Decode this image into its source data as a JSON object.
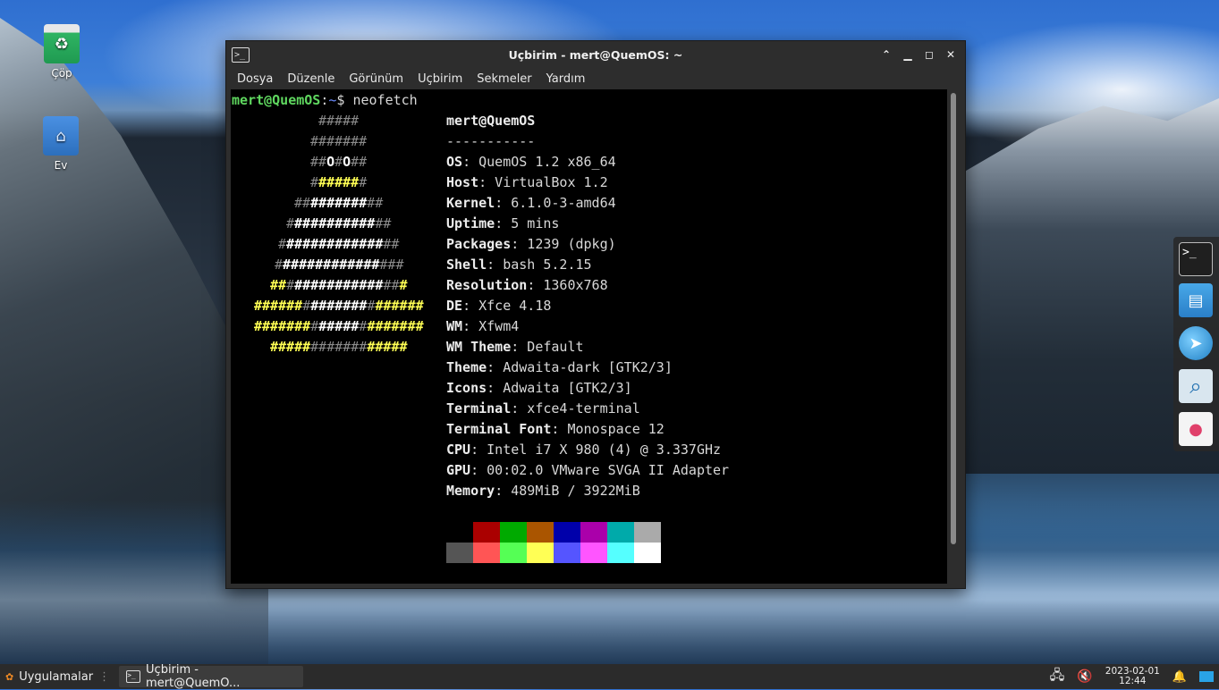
{
  "desktop": {
    "icons": [
      {
        "label": "Çöp"
      },
      {
        "label": "Ev"
      }
    ]
  },
  "window": {
    "title": "Uçbirim - mert@QuemOS: ~",
    "menu": [
      "Dosya",
      "Düzenle",
      "Görünüm",
      "Uçbirim",
      "Sekmeler",
      "Yardım"
    ]
  },
  "terminal": {
    "prompt_user": "mert@QuemOS",
    "prompt_sep": ":",
    "prompt_path": "~",
    "prompt_symbol": "$ ",
    "command": "neofetch",
    "header": "mert@QuemOS",
    "underline": "-----------",
    "info": [
      {
        "key": "OS",
        "value": ": QuemOS 1.2 x86_64"
      },
      {
        "key": "Host",
        "value": ": VirtualBox 1.2"
      },
      {
        "key": "Kernel",
        "value": ": 6.1.0-3-amd64"
      },
      {
        "key": "Uptime",
        "value": ": 5 mins"
      },
      {
        "key": "Packages",
        "value": ": 1239 (dpkg)"
      },
      {
        "key": "Shell",
        "value": ": bash 5.2.15"
      },
      {
        "key": "Resolution",
        "value": ": 1360x768"
      },
      {
        "key": "DE",
        "value": ": Xfce 4.18"
      },
      {
        "key": "WM",
        "value": ": Xfwm4"
      },
      {
        "key": "WM Theme",
        "value": ": Default"
      },
      {
        "key": "Theme",
        "value": ": Adwaita-dark [GTK2/3]"
      },
      {
        "key": "Icons",
        "value": ": Adwaita [GTK2/3]"
      },
      {
        "key": "Terminal",
        "value": ": xfce4-terminal"
      },
      {
        "key": "Terminal Font",
        "value": ": Monospace 12"
      },
      {
        "key": "CPU",
        "value": ": Intel i7 X 980 (4) @ 3.337GHz"
      },
      {
        "key": "GPU",
        "value": ": 00:02.0 VMware SVGA II Adapter"
      },
      {
        "key": "Memory",
        "value": ": 489MiB / 3922MiB"
      }
    ],
    "ascii": [
      [
        [
          "gry",
          "#####"
        ]
      ],
      [
        [
          "gry",
          "#######"
        ]
      ],
      [
        [
          "gry",
          "##"
        ],
        [
          "wh",
          "O"
        ],
        [
          "gry",
          "#"
        ],
        [
          "wh",
          "O"
        ],
        [
          "gry",
          "##"
        ]
      ],
      [
        [
          "gry",
          "#"
        ],
        [
          "yl",
          "#####"
        ],
        [
          "gry",
          "#"
        ]
      ],
      [
        [
          "gry",
          "##"
        ],
        [
          "wh",
          "#######"
        ],
        [
          "gry",
          "##"
        ]
      ],
      [
        [
          "gry",
          "#"
        ],
        [
          "wh",
          "##########"
        ],
        [
          "gry",
          "##"
        ]
      ],
      [
        [
          "gry",
          "#"
        ],
        [
          "wh",
          "############"
        ],
        [
          "gry",
          "##"
        ]
      ],
      [
        [
          "gry",
          "#"
        ],
        [
          "wh",
          "############"
        ],
        [
          "gry",
          "###"
        ]
      ],
      [
        [
          "yl",
          "##"
        ],
        [
          "gry",
          "#"
        ],
        [
          "wh",
          "###########"
        ],
        [
          "gry",
          "##"
        ],
        [
          "yl",
          "#"
        ]
      ],
      [
        [
          "yl",
          "######"
        ],
        [
          "gry",
          "#"
        ],
        [
          "wh",
          "#######"
        ],
        [
          "gry",
          "#"
        ],
        [
          "yl",
          "######"
        ]
      ],
      [
        [
          "yl",
          "#######"
        ],
        [
          "gry",
          "#"
        ],
        [
          "wh",
          "#####"
        ],
        [
          "gry",
          "#"
        ],
        [
          "yl",
          "#######"
        ]
      ],
      [
        [
          "yl",
          "#####"
        ],
        [
          "gry",
          "#######"
        ],
        [
          "yl",
          "#####"
        ]
      ]
    ],
    "palette_top": [
      "#000000",
      "#aa0000",
      "#00aa00",
      "#aa5500",
      "#0000aa",
      "#aa00aa",
      "#00aaaa",
      "#aaaaaa"
    ],
    "palette_bottom": [
      "#555555",
      "#ff5555",
      "#55ff55",
      "#ffff55",
      "#5555ff",
      "#ff55ff",
      "#55ffff",
      "#ffffff"
    ]
  },
  "dock": {
    "items": [
      "terminal-icon",
      "file-manager-icon",
      "web-browser-icon",
      "search-icon",
      "software-store-icon"
    ]
  },
  "taskbar": {
    "apps_menu": "Uygulamalar",
    "task_label": "Uçbirim - mert@QuemO...",
    "date": "2023-02-01",
    "time": "12:44"
  }
}
